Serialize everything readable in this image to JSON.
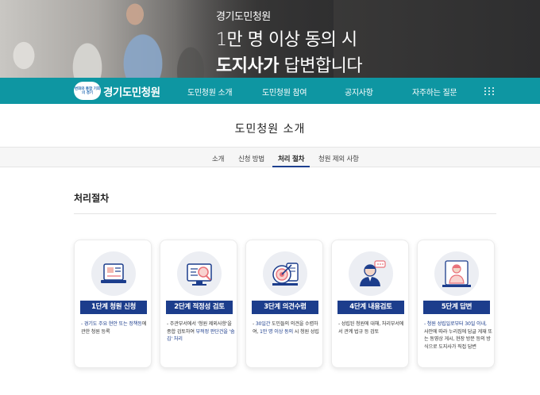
{
  "hero": {
    "subtitle": "경기도민청원",
    "line1": "1만 명 이상 동의 시",
    "line2_bold": "도지사가",
    "line2_rest": " 답변합니다"
  },
  "nav": {
    "logo_badge": "변화와 통합 기회의 경기",
    "logo_text": "경기도민청원",
    "items": [
      "도민청원 소개",
      "도민청원 참여",
      "공지사항",
      "자주하는 질문"
    ]
  },
  "page": {
    "title": "도민청원 소개",
    "tabs": [
      "소개",
      "신청 방법",
      "처리 절차",
      "청원 제외 사항"
    ],
    "active_tab": "처리 절차"
  },
  "section": {
    "title": "처리절차"
  },
  "steps": [
    {
      "label": "1단계 청원 신청",
      "icon": "application-form-icon",
      "desc_hl": "- 경기도 주요 현안 또는 정책등",
      "desc_rest": "에 관한 청원 등록"
    },
    {
      "label": "2단계 적정성 검토",
      "icon": "review-monitor-icon",
      "desc_a": "- 주관부서에서 '청원 제외사항'을 종합 검토하여 ",
      "desc_hl": "부적정 판단건을 '숨김' 처리"
    },
    {
      "label": "3단계 의견수렴",
      "icon": "target-icon",
      "desc_a": "- ",
      "desc_hl": "30일간",
      "desc_b": " 도민들의 의견을 수렴하여, ",
      "desc_hl2": "1만 명 이상 동의",
      "desc_c": " 시 청원 성립"
    },
    {
      "label": "4단계 내용검토",
      "icon": "official-person-icon",
      "desc_a": "- 성립된 청원에 대해, 처리부서에서 관계 법규 등 검토"
    },
    {
      "label": "5단계 답변",
      "icon": "answer-person-icon",
      "desc_hl": "- 청원 성립일로부터 30일 이내,",
      "desc_rest": " 사안에 따라 누리집에 답글 게재 또는 동영상 게시, 현장 방문 등의 방식으로 도지사가 직접 답변"
    }
  ],
  "colors": {
    "nav_teal": "#0e96a2",
    "step_navy": "#1c3d8c"
  }
}
